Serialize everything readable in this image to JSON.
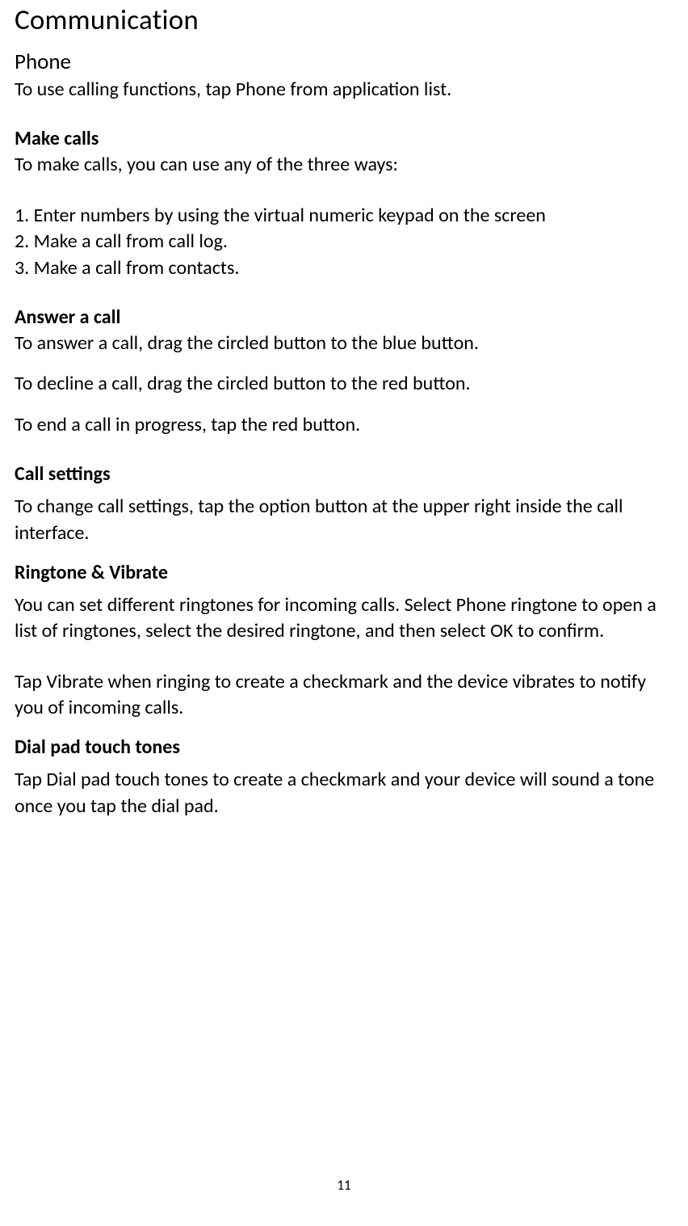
{
  "title": "Communication",
  "section_phone": {
    "heading": "Phone",
    "intro": "To use calling functions, tap Phone from application list."
  },
  "make_calls": {
    "heading": "Make calls",
    "intro": "To make calls, you can use any of the three ways:",
    "items": [
      "1. Enter numbers by using the virtual numeric keypad on the screen",
      "2. Make a call from call log.",
      "3. Make a call from contacts."
    ]
  },
  "answer_call": {
    "heading": "Answer a call",
    "p1": "To answer a call, drag the circled button to the blue button.",
    "p2": "To decline a call, drag the circled button to the red button.",
    "p3": "To end a call in progress, tap the red button."
  },
  "call_settings": {
    "heading": "Call settings",
    "p1": "To change call settings, tap the option button at the upper right inside the call interface."
  },
  "ringtone": {
    "heading": "Ringtone & Vibrate",
    "p1": "You can set different ringtones for incoming calls. Select Phone ringtone to open a list of ringtones, select the desired ringtone, and then select OK to confirm.",
    "p2": "Tap Vibrate when ringing to create a checkmark and the device vibrates to notify you of incoming calls."
  },
  "dialpad": {
    "heading": "Dial pad touch tones",
    "p1": "Tap Dial pad touch tones to create a checkmark and your device will sound a tone once you tap the dial pad."
  },
  "page_number": "11"
}
